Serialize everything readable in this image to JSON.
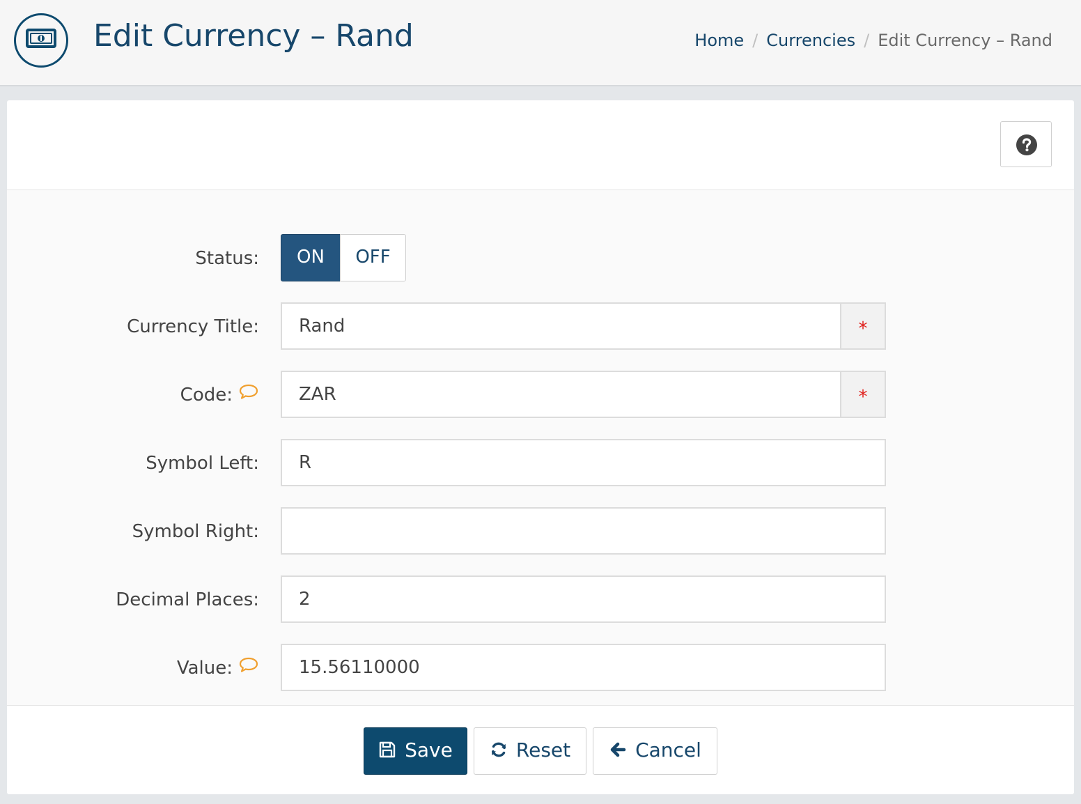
{
  "header": {
    "title": "Edit Currency – Rand",
    "logo_icon": "money-bill-icon",
    "breadcrumb": {
      "home": "Home",
      "separator": "/",
      "currencies": "Currencies",
      "current": "Edit Currency – Rand"
    }
  },
  "toolbar": {
    "help_icon": "question-circle-icon"
  },
  "form": {
    "status": {
      "label": "Status:",
      "on_label": "ON",
      "off_label": "OFF",
      "selected": "ON"
    },
    "currency_title": {
      "label": "Currency Title:",
      "value": "Rand",
      "required_mark": "*"
    },
    "code": {
      "label": "Code:",
      "value": "ZAR",
      "required_mark": "*",
      "tooltip_icon": "comment-icon"
    },
    "symbol_left": {
      "label": "Symbol Left:",
      "value": "R"
    },
    "symbol_right": {
      "label": "Symbol Right:",
      "value": ""
    },
    "decimal_places": {
      "label": "Decimal Places:",
      "value": "2"
    },
    "value": {
      "label": "Value:",
      "value": "15.56110000",
      "tooltip_icon": "comment-icon"
    }
  },
  "actions": {
    "save_label": "Save",
    "reset_label": "Reset",
    "cancel_label": "Cancel"
  },
  "colors": {
    "primary": "#0d4a6e",
    "toggle_on": "#24557f",
    "link": "#17476b",
    "required": "#e0201c",
    "tooltip": "#f0a030"
  }
}
